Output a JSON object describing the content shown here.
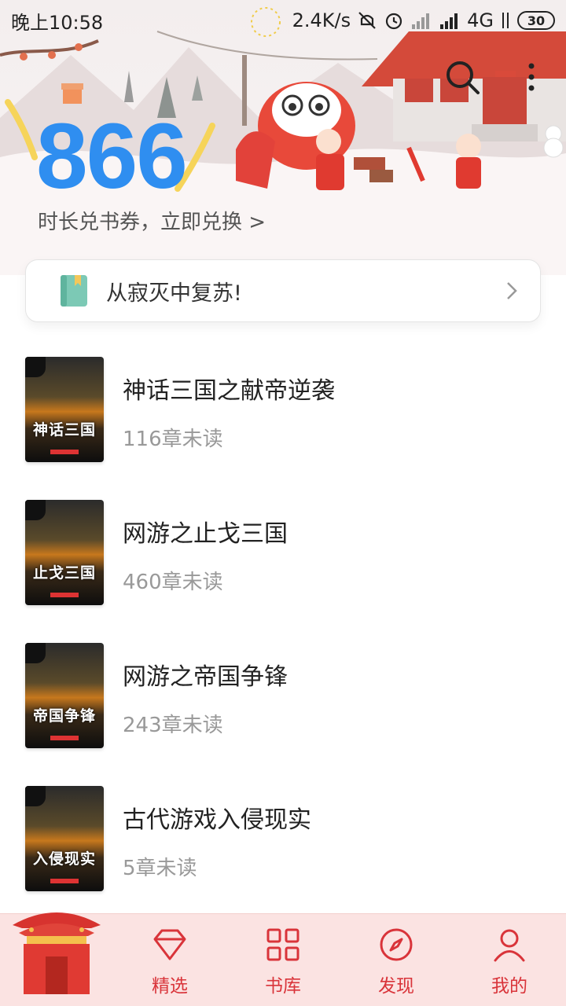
{
  "status_bar": {
    "time": "晚上10:58",
    "speed": "2.4K/s",
    "network": "4G",
    "battery": "30"
  },
  "header": {
    "duration_value": "866",
    "coupon_link": "时长兑书券，立即兑换 >"
  },
  "notice": {
    "text": "从寂灭中复苏!"
  },
  "books": [
    {
      "title": "神话三国之献帝逆袭",
      "unread": "116章未读",
      "cover_text": "神话三国"
    },
    {
      "title": "网游之止戈三国",
      "unread": "460章未读",
      "cover_text": "止戈三国"
    },
    {
      "title": "网游之帝国争锋",
      "unread": "243章未读",
      "cover_text": "帝国争锋"
    },
    {
      "title": "古代游戏入侵现实",
      "unread": "5章未读",
      "cover_text": "入侵现实"
    }
  ],
  "bottom_nav": [
    {
      "label": "精选",
      "icon": "diamond-icon"
    },
    {
      "label": "书库",
      "icon": "grid-icon"
    },
    {
      "label": "发现",
      "icon": "compass-icon"
    },
    {
      "label": "我的",
      "icon": "person-icon"
    }
  ],
  "colors": {
    "accent_blue": "#2f8ef0",
    "nav_red": "#d9343a",
    "nav_bg": "#fbe3e2"
  }
}
